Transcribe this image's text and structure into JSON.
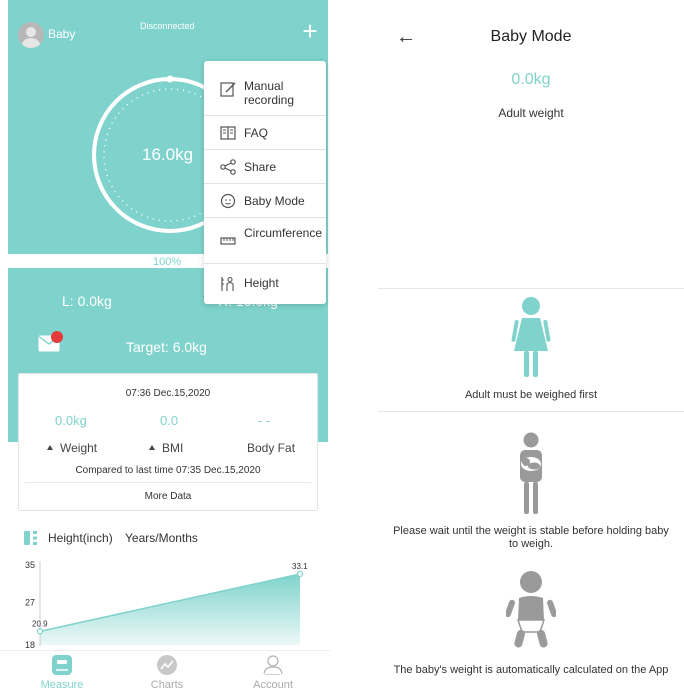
{
  "colors": {
    "accent": "#7fd3cc",
    "badge": "#e43b3b",
    "figure_active": "#7fd3cc",
    "figure_gray": "#9a9a9a"
  },
  "left": {
    "topbar": {
      "name": "Baby",
      "status": "Disconnected",
      "add_icon": "plus-icon"
    },
    "ring": {
      "weight": "16.0kg",
      "percent": "100%",
      "progress": 1.0
    },
    "lr": {
      "left": "L: 0.0kg",
      "right": "R: 16.0kg"
    },
    "target": "Target: 6.0kg",
    "menu": [
      {
        "icon": "edit-icon",
        "label": "Manual recording"
      },
      {
        "icon": "book-icon",
        "label": "FAQ"
      },
      {
        "icon": "share-icon",
        "label": "Share"
      },
      {
        "icon": "baby-face-icon",
        "label": "Baby Mode"
      },
      {
        "icon": "ruler-icon",
        "label": "Circumference"
      },
      {
        "icon": "height-icon",
        "label": "Height"
      }
    ],
    "card": {
      "date": "07:36 Dec.15,2020",
      "metrics": [
        {
          "value": "0.0kg",
          "label": "Weight",
          "arrow": true
        },
        {
          "value": "0.0",
          "label": "BMI",
          "arrow": true
        },
        {
          "value": "- -",
          "label": "Body Fat",
          "arrow": false
        }
      ],
      "compare": "Compared to last time 07:35 Dec.15,2020",
      "more": "More Data"
    },
    "height_section": {
      "title": "Height(inch)",
      "subtitle": "Years/Months"
    },
    "tabs": [
      {
        "icon": "scale-icon",
        "label": "Measure",
        "active": true
      },
      {
        "icon": "chart-icon",
        "label": "Charts",
        "active": false
      },
      {
        "icon": "person-icon",
        "label": "Account",
        "active": false
      }
    ]
  },
  "chart_data": {
    "type": "area",
    "title": "Height(inch)",
    "xlabel": "Years/Months",
    "ylabel": "",
    "y_ticks": [
      "35",
      "27",
      "18"
    ],
    "ylim": [
      18,
      35
    ],
    "series": [
      {
        "points": [
          {
            "x": 0,
            "y": 20.9,
            "label": "20.9"
          },
          {
            "x": 1,
            "y": 33.1,
            "label": "33.1"
          }
        ]
      }
    ]
  },
  "right": {
    "title": "Baby Mode",
    "weight": "0.0kg",
    "weight_label": "Adult weight",
    "steps": [
      {
        "icon": "adult-figure-icon",
        "text": "Adult must be weighed first",
        "active": true
      },
      {
        "icon": "adult-holding-baby-icon",
        "text": "Please wait until the weight is stable before holding baby to weigh.",
        "active": false
      },
      {
        "icon": "baby-figure-icon",
        "text": "The baby's weight is automatically calculated on the App",
        "active": false
      }
    ]
  }
}
